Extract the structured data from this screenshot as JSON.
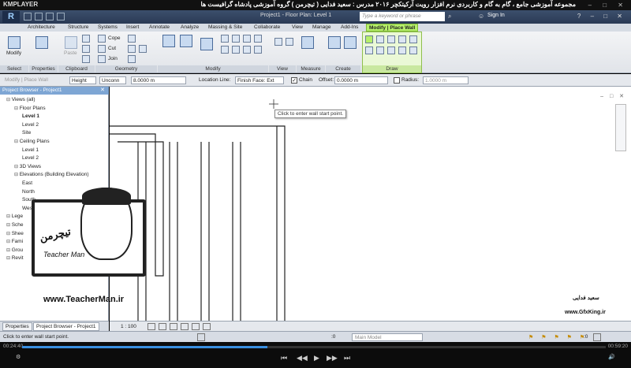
{
  "player": {
    "logo": "KMPLAYER",
    "title": "مجموعه آموزشی جامع ، گام به گام و کاربردی نرم افزار رویت آرکیتکچر ۲۰۱۶  مدرس : سعید فدایی ( تیچرمن ) گروه آموزشی پادشاه گرافیست ها",
    "elapsed": "00:24:40",
    "total": "00:59:20",
    "progress": 0.42
  },
  "app": {
    "logo": "R",
    "doc_title": "Project1 - Floor Plan: Level 1",
    "search_placeholder": "Type a keyword or phrase",
    "signin": "Sign In"
  },
  "tabs": [
    "Architecture",
    "Structure",
    "Systems",
    "Insert",
    "Annotate",
    "Analyze",
    "Massing & Site",
    "Collaborate",
    "View",
    "Manage",
    "Add-Ins",
    "Modify | Place Wall"
  ],
  "ribbon": {
    "modify_label": "Modify",
    "properties_label": "Properties",
    "paste_label": "Paste",
    "cope_label": "Cope",
    "cut_label": "Cut",
    "join_label": "Join",
    "panels": [
      "Select",
      "Properties",
      "Clipboard",
      "Geometry",
      "Modify",
      "View",
      "Measure",
      "Create",
      "Draw"
    ]
  },
  "options_bar": {
    "context": "Modify | Place Wall",
    "height_select": "Height",
    "unconn_select": "Unconn",
    "height_value": "8.0000 m",
    "location_line_label": "Location Line:",
    "location_line_value": "Finish Face: Ext",
    "chain_label": "Chain",
    "offset_label": "Offset:",
    "offset_value": "0.0000 m",
    "radius_label": "Radius:",
    "radius_value": "1.0000 m"
  },
  "project_browser": {
    "title": "Project Browser - Project1",
    "items": [
      {
        "label": "Views (all)",
        "level": 0,
        "bold": false
      },
      {
        "label": "Floor Plans",
        "level": 1,
        "bold": false
      },
      {
        "label": "Level 1",
        "level": 2,
        "bold": true
      },
      {
        "label": "Level 2",
        "level": 2,
        "bold": false
      },
      {
        "label": "Site",
        "level": 2,
        "bold": false
      },
      {
        "label": "Ceiling Plans",
        "level": 1,
        "bold": false
      },
      {
        "label": "Level 1",
        "level": 2,
        "bold": false
      },
      {
        "label": "Level 2",
        "level": 2,
        "bold": false
      },
      {
        "label": "3D Views",
        "level": 1,
        "bold": false
      },
      {
        "label": "Elevations (Building Elevation)",
        "level": 1,
        "bold": false
      },
      {
        "label": "East",
        "level": 2,
        "bold": false
      },
      {
        "label": "North",
        "level": 2,
        "bold": false
      },
      {
        "label": "South",
        "level": 2,
        "bold": false
      },
      {
        "label": "West",
        "level": 2,
        "bold": false
      },
      {
        "label": "Lege",
        "level": 0,
        "bold": false
      },
      {
        "label": "Sche",
        "level": 0,
        "bold": false
      },
      {
        "label": "Shee",
        "level": 0,
        "bold": false
      },
      {
        "label": "Fami",
        "level": 0,
        "bold": false
      },
      {
        "label": "Grou",
        "level": 0,
        "bold": false
      },
      {
        "label": "Revit",
        "level": 0,
        "bold": false
      }
    ],
    "tab_properties": "Properties",
    "tab_browser": "Project Browser - Project1"
  },
  "canvas": {
    "tooltip": "Click to enter wall start point.",
    "scale": "1 : 100"
  },
  "status": {
    "text": "Click to enter wall start point.",
    "model": "Main Model",
    "zero": ":0"
  },
  "watermark": {
    "logo": "تیچرمن",
    "name": "Teacher Man",
    "url": "www.TeacherMan.ir",
    "gfx_name": "سعید فدایی",
    "gfx_url": "www.GfxKing.ir"
  }
}
